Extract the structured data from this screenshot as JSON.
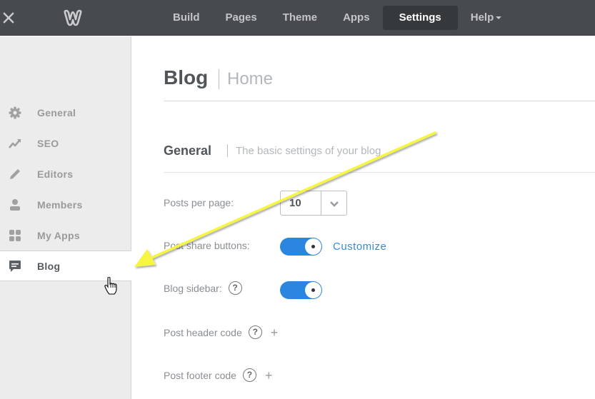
{
  "topbar": {
    "close_icon": "close-icon",
    "logo_icon": "weebly-logo-icon",
    "nav": [
      {
        "label": "Build",
        "active": false
      },
      {
        "label": "Pages",
        "active": false
      },
      {
        "label": "Theme",
        "active": false
      },
      {
        "label": "Apps",
        "active": false
      },
      {
        "label": "Settings",
        "active": true
      },
      {
        "label": "Help",
        "active": false,
        "has_dropdown": true
      }
    ]
  },
  "sidebar": {
    "items": [
      {
        "label": "General",
        "icon": "gear-icon",
        "active": false
      },
      {
        "label": "SEO",
        "icon": "trend-icon",
        "active": false
      },
      {
        "label": "Editors",
        "icon": "pencil-icon",
        "active": false
      },
      {
        "label": "Members",
        "icon": "person-icon",
        "active": false
      },
      {
        "label": "My Apps",
        "icon": "grid-icon",
        "active": false
      },
      {
        "label": "Blog",
        "icon": "comment-icon",
        "active": true
      }
    ]
  },
  "main": {
    "title": "Blog",
    "subtitle": "Home",
    "section": {
      "title": "General",
      "subtitle": "The basic settings of your blog"
    },
    "settings": {
      "posts_per_page": {
        "label": "Posts per page:",
        "value": "10"
      },
      "post_share_buttons": {
        "label": "Post share buttons:",
        "enabled": true,
        "link": "Customize"
      },
      "blog_sidebar": {
        "label": "Blog sidebar:",
        "enabled": true,
        "help": "?"
      },
      "post_header_code": {
        "label": "Post header code",
        "help": "?",
        "add": "+"
      },
      "post_footer_code": {
        "label": "Post footer code",
        "help": "?",
        "add": "+"
      }
    }
  },
  "colors": {
    "topbar": "#474b4f",
    "accent": "#2a86e0",
    "link": "#3a8ad3",
    "annotation_arrow": "#f5f542"
  }
}
